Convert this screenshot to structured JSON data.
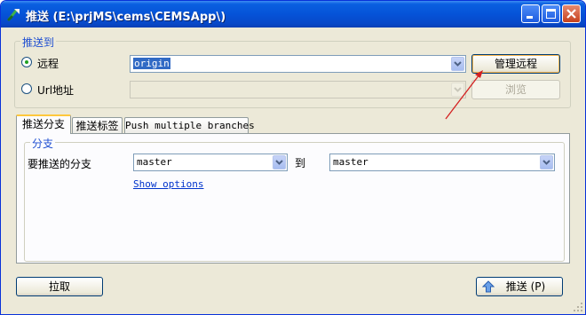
{
  "window": {
    "title": "推送 (E:\\prjMS\\cems\\CEMSApp\\)",
    "controls": [
      "minimize-icon",
      "maximize-icon",
      "close-icon"
    ]
  },
  "push_to": {
    "group_label": "推送到",
    "remote_label": "远程",
    "remote_selected": true,
    "remote_value": "origin",
    "manage_remotes_button": "管理远程",
    "url_label": "Url地址",
    "url_selected": false,
    "url_value": "",
    "browse_button": "浏览"
  },
  "tabs": [
    {
      "label": "推送分支",
      "active": true
    },
    {
      "label": "推送标签",
      "active": false
    },
    {
      "label": "Push multiple branches",
      "active": false
    }
  ],
  "branch": {
    "group_label": "分支",
    "branch_to_push_label": "要推送的分支",
    "local_branch": "master",
    "to_label": "到",
    "remote_branch": "master",
    "show_options_link": "Show options"
  },
  "footer": {
    "pull_button": "拉取",
    "push_button": "推送 (P)"
  },
  "colors": {
    "title_bar": "#0553d8",
    "group_label": "#1f4fd1",
    "dialog_bg": "#ece9d8",
    "annotation_arrow": "#d42020"
  }
}
